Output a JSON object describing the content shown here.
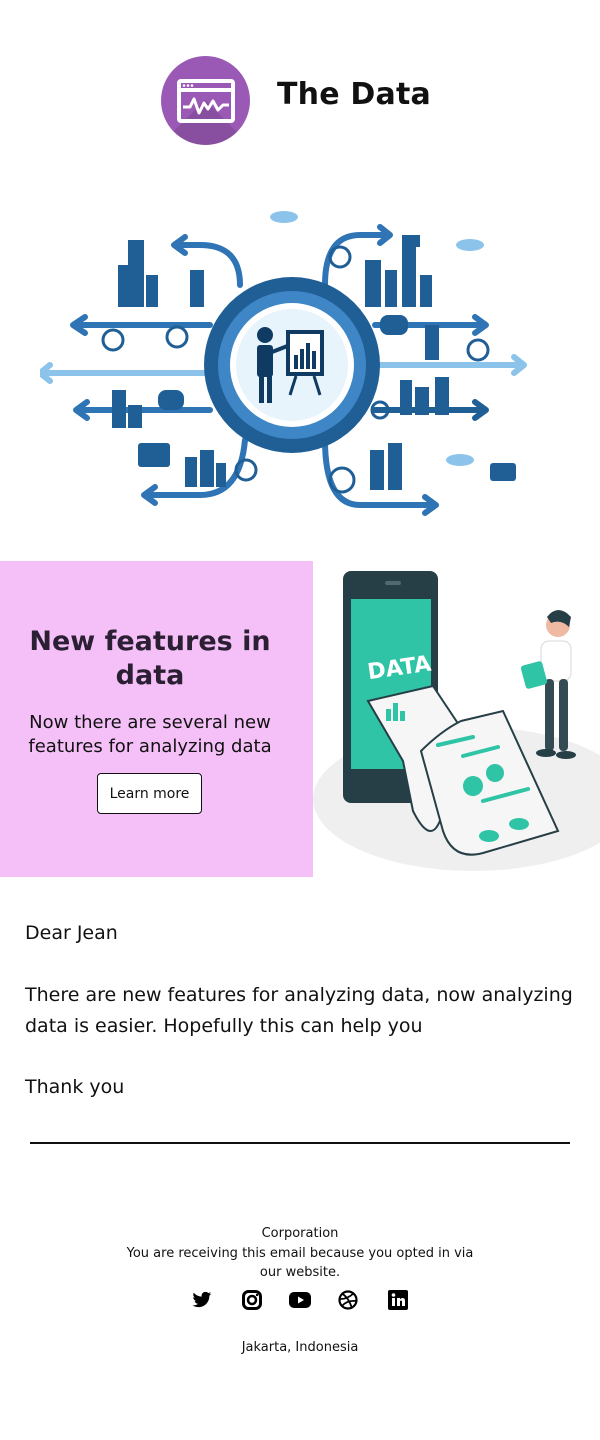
{
  "header": {
    "title": "The Data",
    "logo_icon": "analytics-window-icon",
    "logo_color": "#9b59b6"
  },
  "hero": {
    "icon": "data-network-illustration"
  },
  "feature": {
    "title": "New features in data",
    "text": "Now there are several new features for analyzing data",
    "button_label": "Learn more",
    "background": "#f5c0f8",
    "illustration_label": "DATA",
    "illustration_icon": "data-report-illustration"
  },
  "letter": {
    "greeting": "Dear Jean",
    "message": "There are new features for analyzing data, now analyzing data is easier. Hopefully this can help you",
    "closing": "Thank you"
  },
  "footer": {
    "company": "Corporation",
    "note": "You are receiving this email because you opted in via our website.",
    "socials": [
      {
        "name": "twitter-icon"
      },
      {
        "name": "instagram-icon"
      },
      {
        "name": "youtube-icon"
      },
      {
        "name": "dribbble-icon"
      },
      {
        "name": "linkedin-icon"
      }
    ],
    "address": "Jakarta, Indonesia"
  }
}
